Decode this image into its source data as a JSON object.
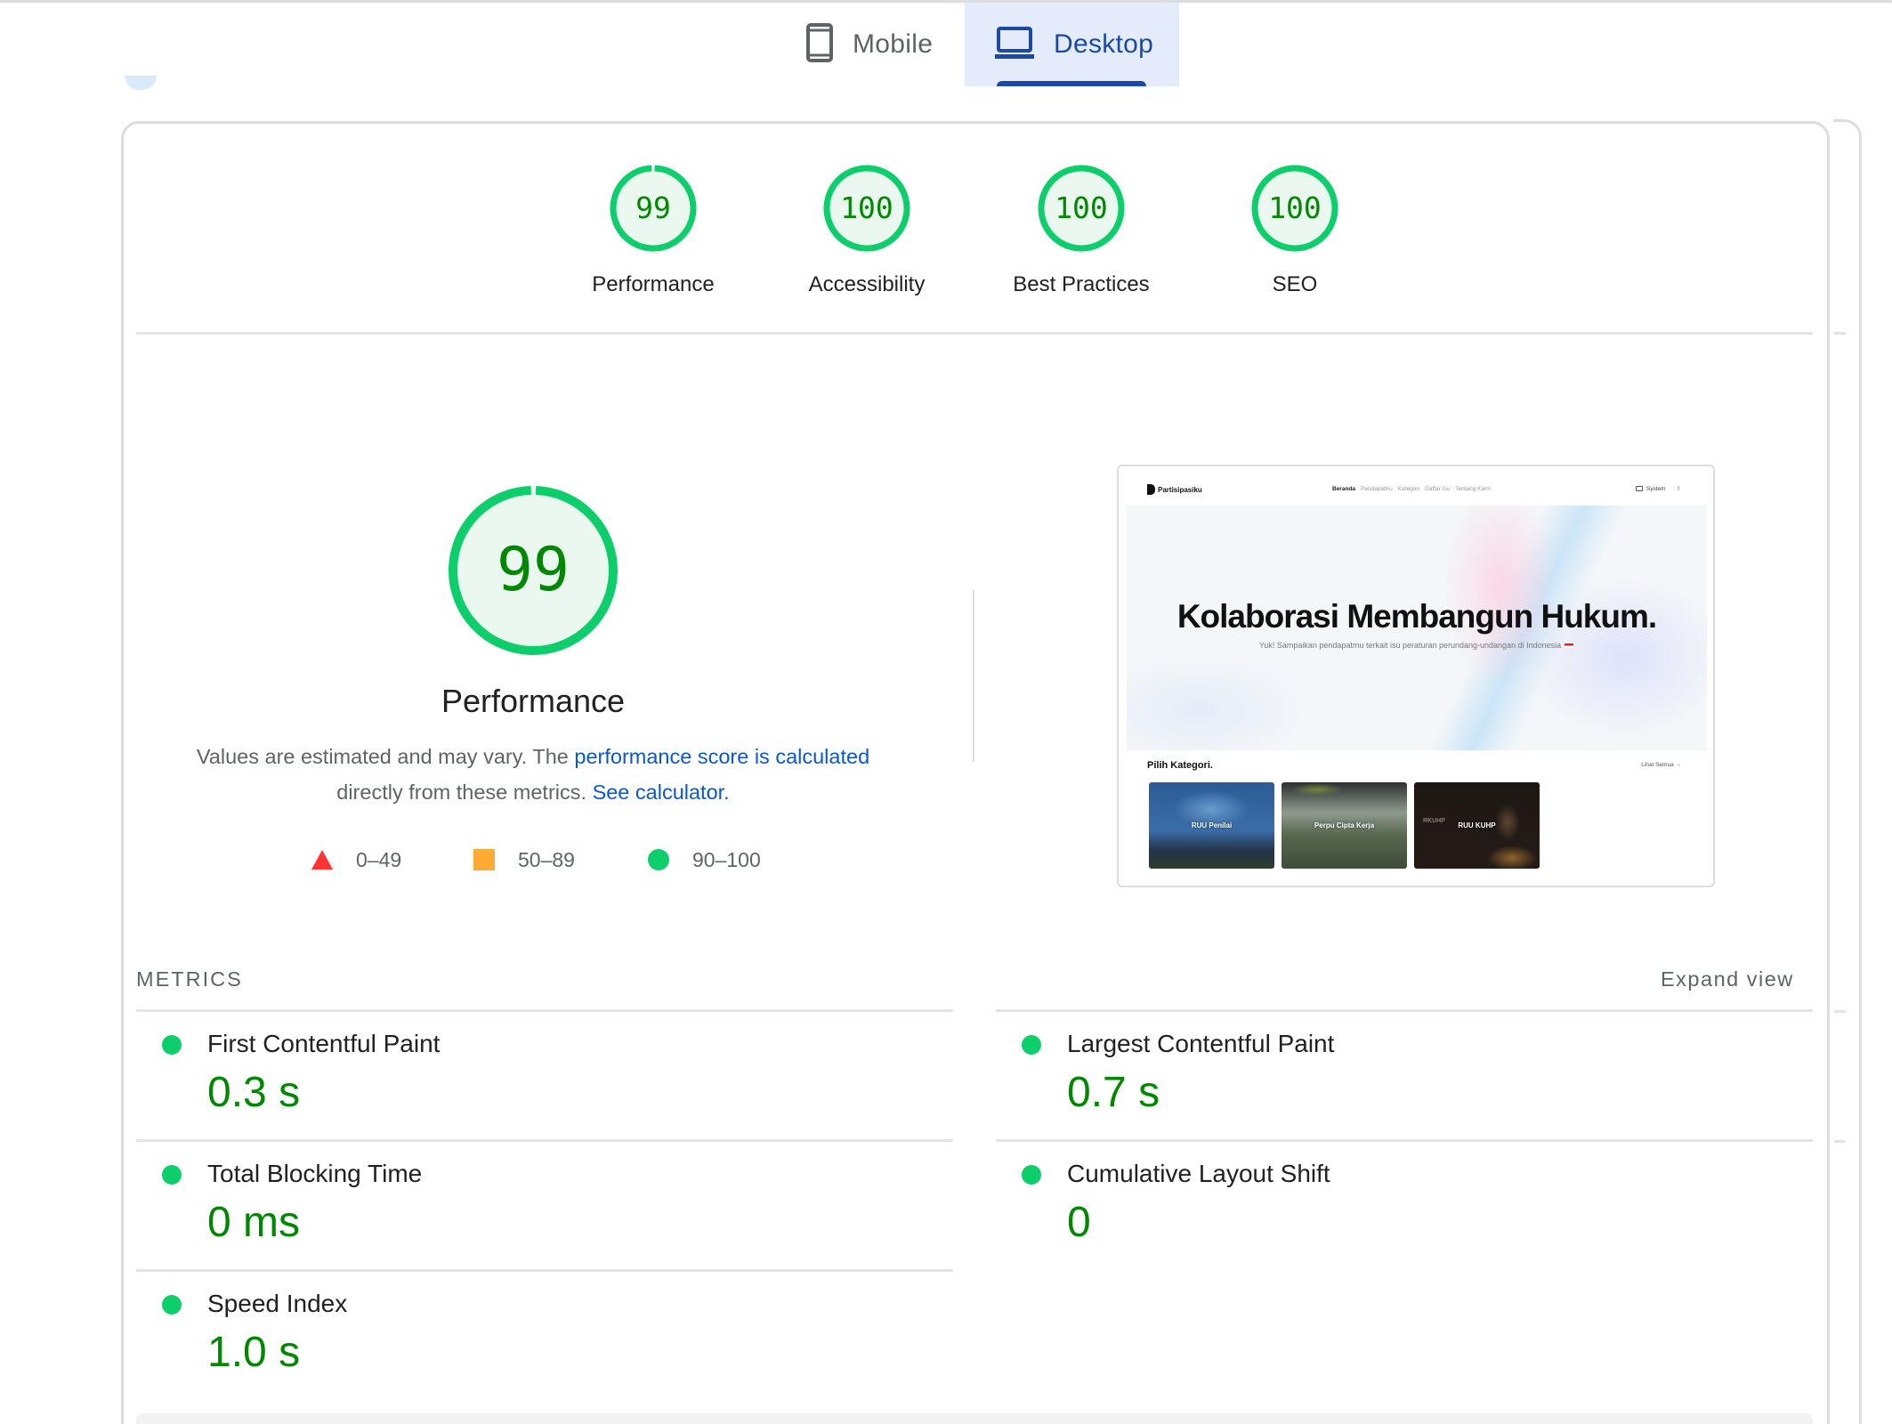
{
  "tabs": [
    {
      "label": "Mobile",
      "icon": "mobile-phone-icon",
      "active": false
    },
    {
      "label": "Desktop",
      "icon": "laptop-icon",
      "active": true
    }
  ],
  "colors": {
    "pass": "#0cce6b",
    "pass_text": "#008800",
    "average": "#ffaa33",
    "fail": "#ff3333",
    "link": "#0b57d0",
    "tab_active": "#1a4aa6",
    "tab_active_bg": "#e4ecfb"
  },
  "summary": {
    "gauges": [
      {
        "label": "Performance",
        "score": "99",
        "fraction": 0.99
      },
      {
        "label": "Accessibility",
        "score": "100",
        "fraction": 1.0
      },
      {
        "label": "Best Practices",
        "score": "100",
        "fraction": 1.0
      },
      {
        "label": "SEO",
        "score": "100",
        "fraction": 1.0
      }
    ]
  },
  "performance": {
    "score": "99",
    "fraction": 0.99,
    "title": "Performance",
    "desc_prefix": "Values are estimated and may vary. The ",
    "desc_link1": "performance score is calculated",
    "desc_middle": " directly from these metrics. ",
    "desc_link2": "See calculator.",
    "legend": [
      {
        "shape": "triangle",
        "range": "0–49"
      },
      {
        "shape": "square",
        "range": "50–89"
      },
      {
        "shape": "circle",
        "range": "90–100"
      }
    ]
  },
  "screenshot": {
    "brand": "Partisipasiku",
    "nav_links": [
      "Beranda",
      "PendapatKu",
      "Kategori",
      "Daftar Isu",
      "Tentang Kami"
    ],
    "theme_label": "System",
    "hero_title": "Kolaborasi Membangun Hukum.",
    "hero_subtitle": "Yuk! Sampaikan pendapatmu terkait isu peraturan perundang-undangan di Indonesia",
    "category_heading": "Pilih Kategori.",
    "see_all": "Lihat Semua →",
    "categories": [
      "RUU Penilai",
      "Perpu Cipta Kerja",
      "RUU KUHP"
    ],
    "card3_watermark": "RKUHP"
  },
  "metrics": {
    "heading": "METRICS",
    "expand_label": "Expand view",
    "items": [
      {
        "label": "First Contentful Paint",
        "value": "0.3 s",
        "status": "pass"
      },
      {
        "label": "Largest Contentful Paint",
        "value": "0.7 s",
        "status": "pass"
      },
      {
        "label": "Total Blocking Time",
        "value": "0 ms",
        "status": "pass"
      },
      {
        "label": "Cumulative Layout Shift",
        "value": "0",
        "status": "pass"
      },
      {
        "label": "Speed Index",
        "value": "1.0 s",
        "status": "pass"
      }
    ]
  }
}
